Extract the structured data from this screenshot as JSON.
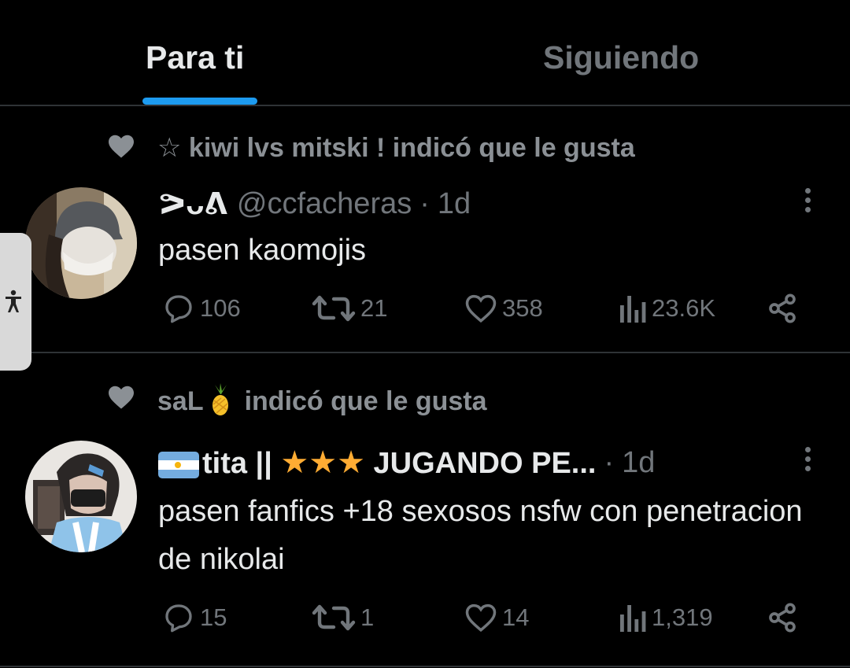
{
  "tabs": {
    "for_you": "Para ti",
    "following": "Siguiendo",
    "active": "for_you"
  },
  "accessibility": {
    "icon": "person-accessibility-icon"
  },
  "tweets": [
    {
      "social_context": "☆ kiwi lvs mitski ! indicó que le gusta",
      "display_name": "ᕗᴗᕕ",
      "handle": "@ccfacheras",
      "time": "1d",
      "text": "pasen kaomojis",
      "replies": "106",
      "retweets": "21",
      "likes": "358",
      "views": "23.6K"
    },
    {
      "social_context_name": "saL",
      "social_context_suffix": "indicó que le gusta",
      "display_name": "tita || ",
      "display_name_rest": " JUGANDO PE...",
      "time": "1d",
      "text": "pasen fanfics +18 sexosos nsfw con penetracion de nikolai",
      "replies": "15",
      "retweets": "1",
      "likes": "14",
      "views": "1,319"
    }
  ],
  "colors": {
    "background": "#000000",
    "accent": "#1d9bf0",
    "muted": "#71767b",
    "text": "#e7e9ea",
    "divider": "#2f3336"
  }
}
